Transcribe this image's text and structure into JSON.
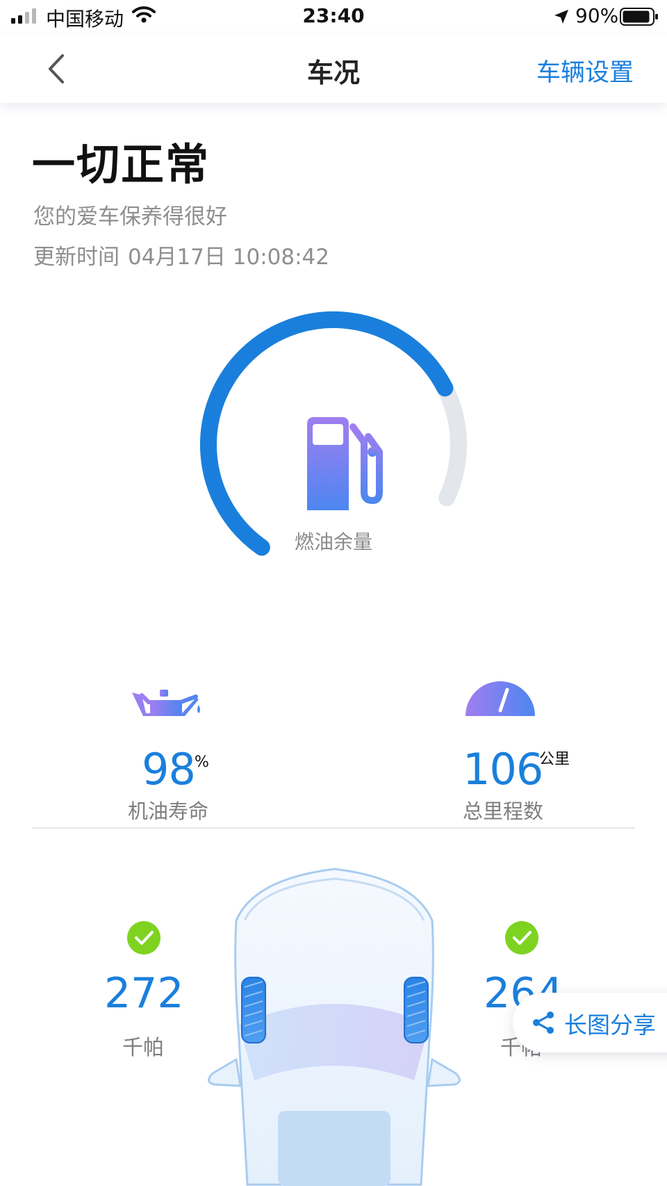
{
  "status_bar": {
    "carrier": "中国移动",
    "time": "23:40",
    "battery_percent": "90%",
    "icons": [
      "signal-icon",
      "wifi-icon",
      "location-arrow-icon",
      "battery-icon"
    ]
  },
  "nav": {
    "title": "车况",
    "settings_label": "车辆设置",
    "back_icon": "chevron-left-icon"
  },
  "summary": {
    "title": "一切正常",
    "subtitle": "您的爱车保养得很好",
    "update_label": "更新时间",
    "update_time": "04月17日 10:08:42"
  },
  "fuel": {
    "label": "燃油余量",
    "level_fraction": 0.8,
    "icon": "fuel-pump-icon"
  },
  "stats": {
    "oil": {
      "value": "98",
      "unit": "%",
      "label": "机油寿命",
      "icon": "oil-can-icon"
    },
    "mileage": {
      "value": "106",
      "unit": "公里",
      "label": "总里程数",
      "icon": "speedometer-icon"
    }
  },
  "tyres": {
    "front_left": {
      "value": "272",
      "unit": "千帕",
      "status_icon": "check-circle-icon"
    },
    "front_right": {
      "value": "264",
      "unit": "千帕",
      "status_icon": "check-circle-icon"
    }
  },
  "share": {
    "label": "长图分享",
    "icon": "share-icon"
  },
  "colors": {
    "accent": "#1a7fdc",
    "ok": "#7ed321",
    "gauge_track": "#e3e6ea",
    "gradient_start": "#a07ef0",
    "gradient_end": "#4d86f0"
  }
}
